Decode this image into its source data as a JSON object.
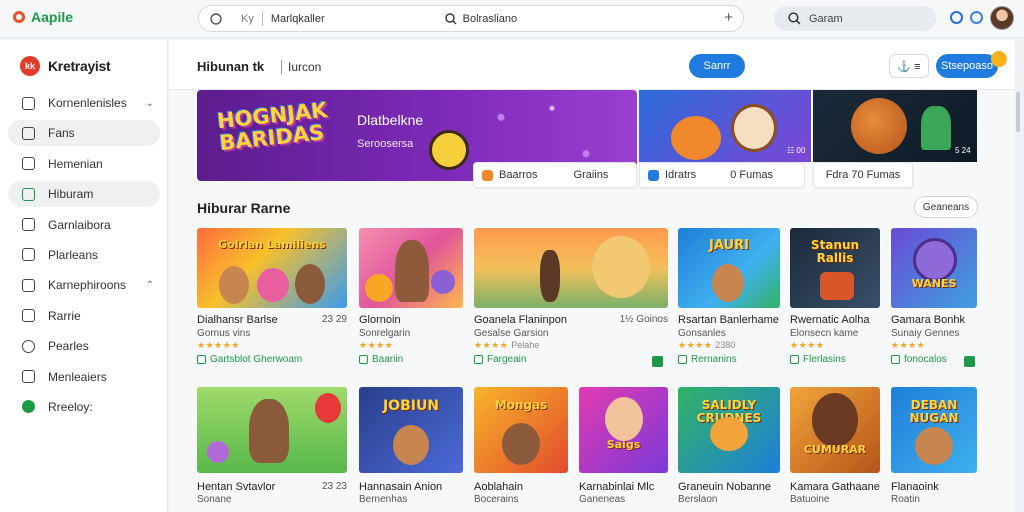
{
  "topbar": {
    "app_name": "Aapile",
    "address_left": "Ky",
    "address_mid": "Marlqkaller",
    "address_right": "Bolrasliano",
    "search_text": "Garam"
  },
  "sidebar": {
    "brand": "Kretrayist",
    "brand_badge": "kk",
    "items": [
      {
        "label": "Kornenlenisles",
        "chevron": "⌄"
      },
      {
        "label": "Fans",
        "chevron": ""
      },
      {
        "label": "Hemenian",
        "chevron": ""
      },
      {
        "label": "Hiburam",
        "chevron": ""
      },
      {
        "label": "Garnlaibora",
        "chevron": ""
      },
      {
        "label": "Plarleans",
        "chevron": ""
      },
      {
        "label": "Karnephiroons",
        "chevron": "⌃"
      },
      {
        "label": "Rarrie",
        "chevron": ""
      },
      {
        "label": "Pearles",
        "chevron": ""
      },
      {
        "label": "Menleaiers",
        "chevron": ""
      },
      {
        "label": "Rreeloy:",
        "chevron": ""
      }
    ]
  },
  "header": {
    "title": "Hibunan tk",
    "subtitle": "Iurcon",
    "blue_button": "Sanrr",
    "ghost_button": "⚓ ≡",
    "action_button": "Stsepoaso"
  },
  "hero": {
    "logo": "HOGNJAK BARIDAS",
    "title": "Dlatbelkne",
    "subtitle": "Seroosersa"
  },
  "banner_tags": {
    "b2": "☷ 00",
    "b3": "5 24"
  },
  "chips": [
    {
      "label": "Baarros",
      "right": "Graiins",
      "icon_color": "#f2882c"
    },
    {
      "label": "Idratrs",
      "right": "0 Fumas",
      "icon_color": "#1f7be0"
    },
    {
      "label": "Fdra 70 Fumas",
      "right": "",
      "icon_color": ""
    }
  ],
  "section": {
    "title": "Hiburar Rarne",
    "button": "Geaneans"
  },
  "cards": [
    {
      "title": "Dialhansr Barlse",
      "right": "23 29",
      "sub": "Gornus vins",
      "stars": "★★★★★",
      "rating": "",
      "link": "Gartsblot Gherwoam",
      "art": "Golrlan Lamiliens"
    },
    {
      "title": "Glornoin",
      "right": "",
      "sub": "Sonrelgarin",
      "stars": "★★★★",
      "rating": "",
      "link": "Baariin",
      "art": ""
    },
    {
      "title": "Goanela Flaninpon",
      "right": "1½ Goinos",
      "sub": "Gesalse Garsion",
      "stars": "★★★★",
      "rating": "Pelahe",
      "link": "Fargeain",
      "art": ""
    },
    {
      "title": "Rsartan Banlerhame",
      "right": "",
      "sub": "Gonsanles",
      "stars": "★★★★",
      "rating": "2380",
      "link": "Rernanins",
      "art": "JAURI"
    },
    {
      "title": "Rwernatic Aolha",
      "right": "",
      "sub": "Elonsecn kame",
      "stars": "★★★★",
      "rating": "",
      "link": "Flerlasins",
      "art": "Stanun Rallis"
    },
    {
      "title": "Gamara Bonhk",
      "right": "",
      "sub": "Sunaiy Gennes",
      "stars": "★★★★",
      "rating": "",
      "link": "fonocalos",
      "art": "WANES"
    },
    {
      "title": "Hentan Svtavlor",
      "right": "23 23",
      "sub": "Sonane",
      "stars": "★★★★★",
      "rating": "",
      "link": "",
      "art": ""
    },
    {
      "title": "Hannasain Anion",
      "right": "",
      "sub": "Bernenhas",
      "stars": "★★★★★",
      "rating": "",
      "link": "",
      "art": "JOBIUN"
    },
    {
      "title": "Aoblahain",
      "right": "",
      "sub": "Bocerains",
      "stars": "★★★★",
      "rating": "",
      "link": "",
      "art": "Mongas"
    },
    {
      "title": "Karnabinlai Mlc",
      "right": "",
      "sub": "Ganeneas",
      "stars": "★★★★",
      "rating": "",
      "link": "",
      "art": "Saigs"
    },
    {
      "title": "Graneuin Nobanne",
      "right": "",
      "sub": "Berslaon",
      "stars": "★★★★",
      "rating": "",
      "link": "",
      "art": "SALIDLY CRUDNES"
    },
    {
      "title": "Kamara Gathaane",
      "right": "",
      "sub": "Batuoine",
      "stars": "★★★★",
      "rating": "",
      "link": "",
      "art": "CUMURAR"
    },
    {
      "title": "Flanaoink",
      "right": "",
      "sub": "Roatin",
      "stars": "★★★★",
      "rating": "",
      "link": "",
      "art": "DEBAN NUGAN"
    }
  ]
}
